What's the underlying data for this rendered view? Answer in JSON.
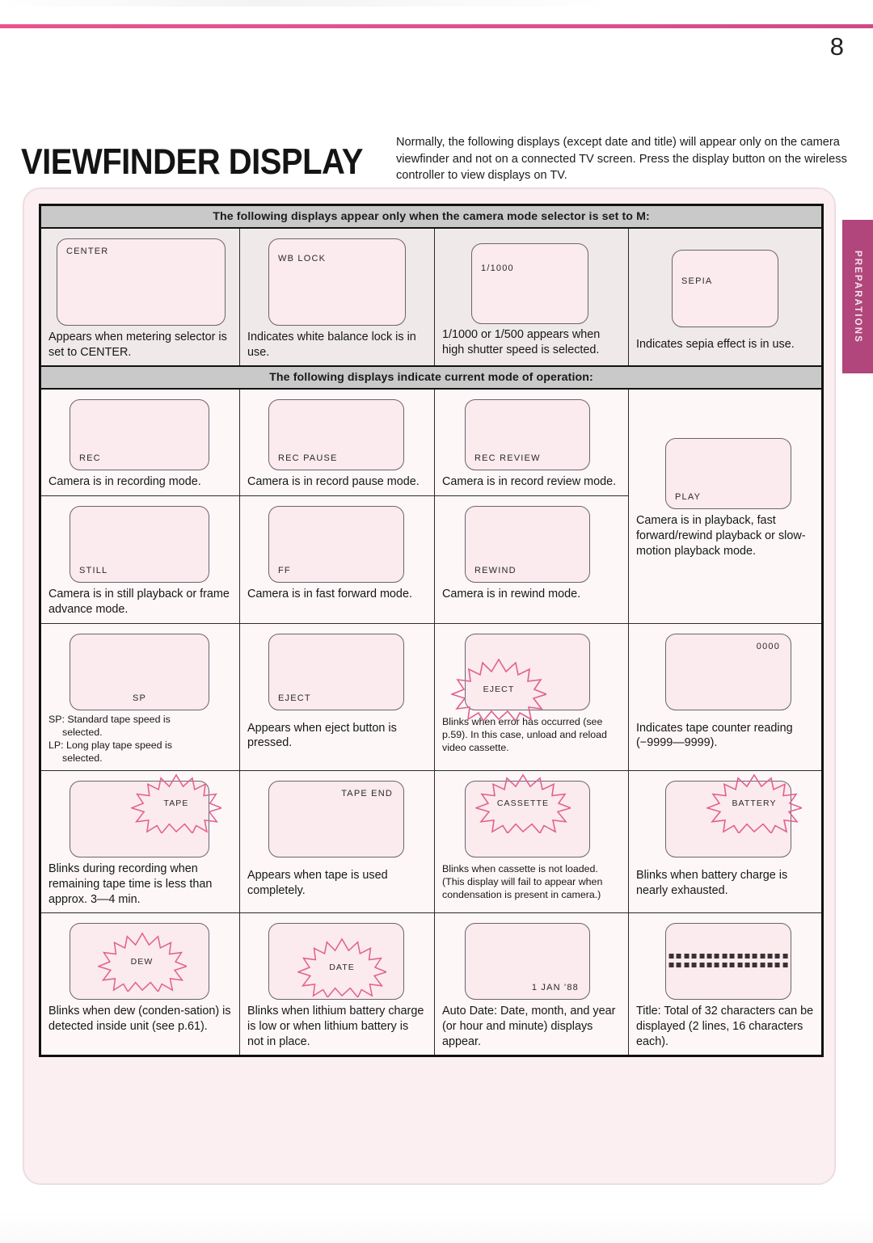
{
  "page": {
    "number": "8",
    "title": "VIEWFINDER DISPLAY",
    "intro": "Normally, the following displays (except date and title) will appear only on the camera viewfinder and not on a connected TV screen. Press the display button on the wireless controller to view displays on TV.",
    "side_tab": "PREPARATIONS",
    "accent_color": "#d9508c",
    "tab_color": "#b0467c",
    "panel_color": "#fbeff1",
    "screen_color": "#fbeaee",
    "blink_color": "#e0608f"
  },
  "bands": {
    "manual_mode": "The following displays appear only when the camera mode selector is set to M:",
    "current_mode": "The following displays indicate current mode of operation:"
  },
  "cells": {
    "center": {
      "screen_label": "CENTER",
      "caption": "Appears when metering selector is set to CENTER."
    },
    "wb_lock": {
      "screen_label": "WB  LOCK",
      "caption": "Indicates white balance lock is in use."
    },
    "shutter": {
      "screen_label": "1/1000",
      "caption": "1/1000 or 1/500 appears when high shutter speed is selected."
    },
    "sepia": {
      "screen_label": "SEPIA",
      "caption": "Indicates sepia effect is in use."
    },
    "rec": {
      "screen_label": "REC",
      "caption": "Camera is in recording mode."
    },
    "rec_pause": {
      "screen_label": "REC  PAUSE",
      "caption": "Camera is in record pause mode."
    },
    "rec_review": {
      "screen_label": "REC  REVIEW",
      "caption": "Camera is in record review mode."
    },
    "play": {
      "screen_label": "PLAY",
      "caption": "Camera is in playback, fast forward/rewind playback or slow-motion playback mode."
    },
    "still": {
      "screen_label": "STILL",
      "caption": "Camera is in still playback or frame advance mode."
    },
    "ff": {
      "screen_label": "FF",
      "caption": "Camera is in fast forward mode."
    },
    "rewind": {
      "screen_label": "REWIND",
      "caption": "Camera is in rewind mode."
    },
    "sp": {
      "screen_label": "SP",
      "caption_line1": "SP: Standard tape speed is",
      "caption_line2": "selected.",
      "caption_line3": "LP: Long play tape speed is",
      "caption_line4": "selected."
    },
    "eject": {
      "screen_label": "EJECT",
      "caption": "Appears when eject button is pressed."
    },
    "eject_blink": {
      "screen_label": "EJECT",
      "caption": "Blinks when error has occurred (see p.59). In this case, unload and reload video cassette."
    },
    "counter": {
      "screen_label": "0000",
      "caption": "Indicates tape counter reading (−9999—9999)."
    },
    "tape": {
      "screen_label": "TAPE",
      "caption": "Blinks during recording when remaining tape time is less than approx. 3—4 min."
    },
    "tape_end": {
      "screen_label": "TAPE  END",
      "caption": "Appears when tape is used completely."
    },
    "cassette": {
      "screen_label": "CASSETTE",
      "caption": "Blinks when cassette is not loaded. (This display will fail to appear when condensation is present in camera.)"
    },
    "battery": {
      "screen_label": "BATTERY",
      "caption": "Blinks when battery charge is nearly exhausted."
    },
    "dew": {
      "screen_label": "DEW",
      "caption": "Blinks when dew (conden-sation) is detected inside unit (see p.61)."
    },
    "date_blink": {
      "screen_label": "DATE",
      "caption": "Blinks when lithium battery charge is low or when lithium battery is not in place."
    },
    "auto_date": {
      "screen_label": "1 JAN '88",
      "caption": "Auto Date: Date, month, and year (or hour and minute) displays appear."
    },
    "title_display": {
      "dots_per_row": 16,
      "rows": 2,
      "caption": "Title: Total of 32 characters can be displayed (2 lines, 16 characters each)."
    }
  }
}
